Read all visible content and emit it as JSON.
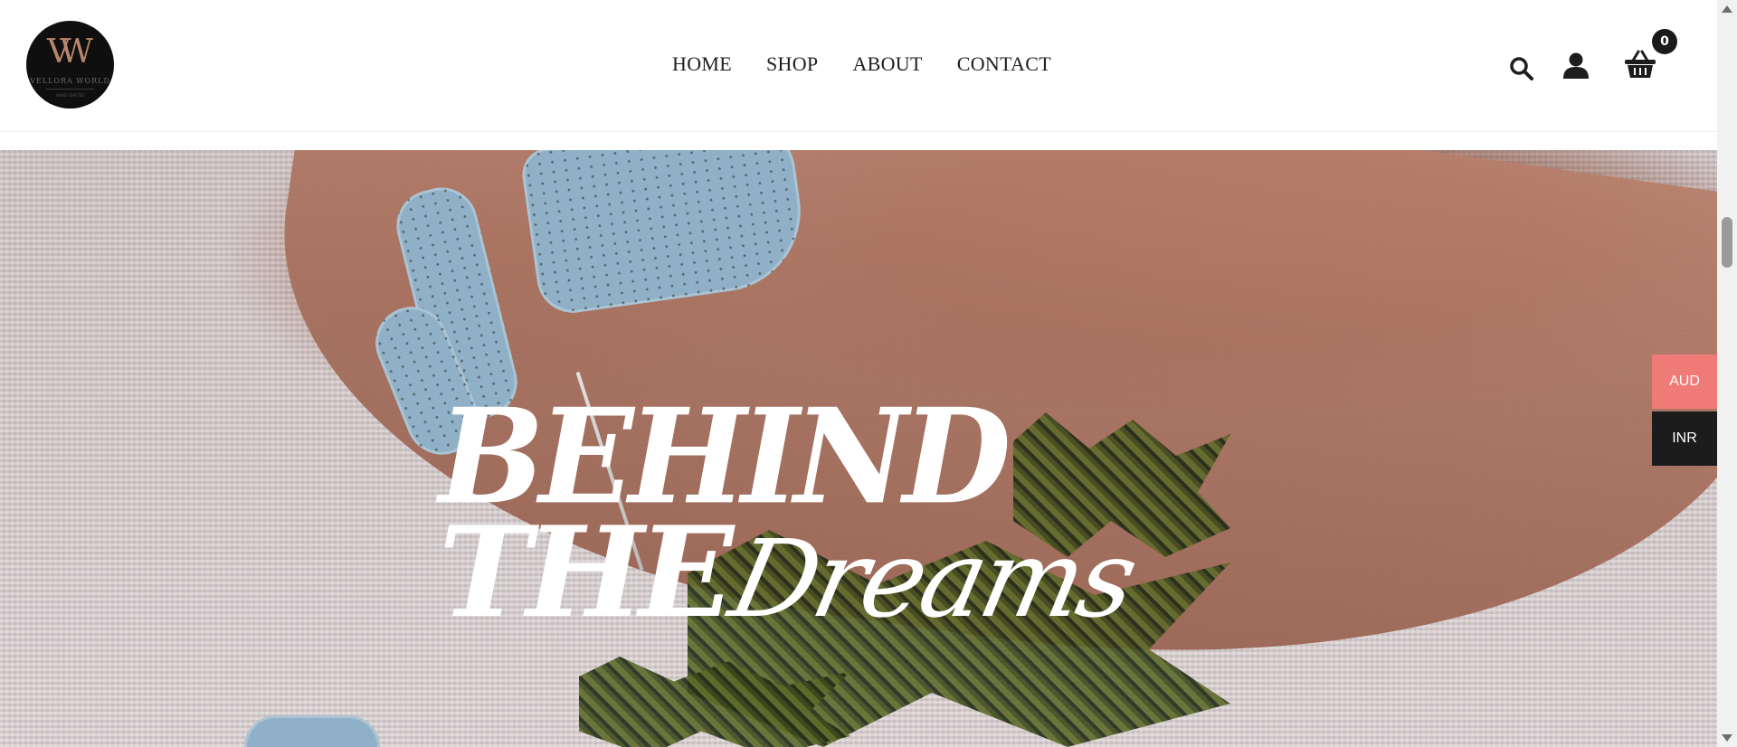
{
  "brand": {
    "logo_monogram": "VW",
    "logo_text": "VELLORA WORLD",
    "logo_subtext": "HAND CRAFTED"
  },
  "nav": {
    "items": [
      "HOME",
      "SHOP",
      "ABOUT",
      "CONTACT"
    ]
  },
  "header_icons": {
    "search": "search-icon",
    "account": "account-icon",
    "cart": "cart-icon",
    "cart_count": "0"
  },
  "hero": {
    "line1": "BEHIND",
    "line2": "THE",
    "line2_script": "Dreams"
  },
  "currency": {
    "options": [
      "AUD",
      "INR"
    ],
    "selected": "AUD"
  },
  "colors": {
    "currency_active": "#ef7a78",
    "currency_inactive": "#1c1c1c",
    "nail_blue": "#8fb0c6"
  }
}
